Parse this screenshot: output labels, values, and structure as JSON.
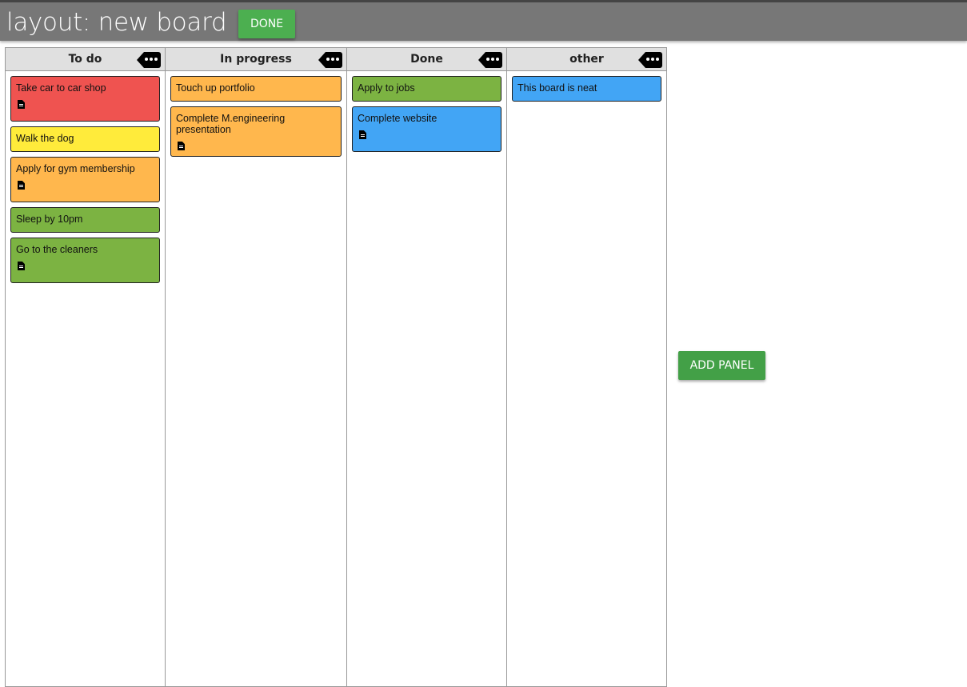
{
  "header": {
    "title": "layout: new board",
    "done_label": "DONE"
  },
  "add_panel_label": "ADD PANEL",
  "colors": {
    "red": "#ef5350",
    "yellow": "#ffeb3b",
    "orange": "#ffb74d",
    "green": "#7cb342",
    "blue": "#42a5f5"
  },
  "columns": [
    {
      "title": "To do",
      "cards": [
        {
          "text": "Take car to car shop",
          "color": "red",
          "note": true
        },
        {
          "text": "Walk the dog",
          "color": "yellow",
          "note": false
        },
        {
          "text": "Apply for gym membership",
          "color": "orange",
          "note": true
        },
        {
          "text": "Sleep by 10pm",
          "color": "green",
          "note": false
        },
        {
          "text": "Go to the cleaners",
          "color": "green",
          "note": true
        }
      ]
    },
    {
      "title": "In progress",
      "cards": [
        {
          "text": "Touch up portfolio",
          "color": "orange",
          "note": false
        },
        {
          "text": "Complete M.engineering presentation",
          "color": "orange",
          "note": true
        }
      ]
    },
    {
      "title": "Done",
      "cards": [
        {
          "text": "Apply to jobs",
          "color": "green",
          "note": false
        },
        {
          "text": "Complete website",
          "color": "blue",
          "note": true
        }
      ]
    },
    {
      "title": "other",
      "cards": [
        {
          "text": "This board is neat",
          "color": "blue",
          "note": false
        }
      ]
    }
  ]
}
